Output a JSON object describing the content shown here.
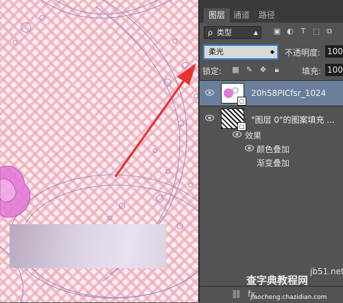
{
  "panel": {
    "tabs": [
      {
        "label": "图层",
        "active": true
      },
      {
        "label": "通道",
        "active": false
      },
      {
        "label": "路径",
        "active": false
      }
    ],
    "filter": {
      "kind_label": "类型",
      "icons": [
        "image-filter-icon",
        "adjustment-filter-icon",
        "text-filter-icon",
        "shape-filter-icon",
        "smart-object-filter-icon"
      ]
    },
    "blend": {
      "mode": "柔光",
      "opacity_label": "不透明度:",
      "opacity_value": "100"
    },
    "lock": {
      "label": "锁定:",
      "fill_label": "填充:",
      "fill_value": "100"
    },
    "layers": [
      {
        "name": "20h58PICfsr_1024",
        "selected": true,
        "visible": true
      },
      {
        "name": "\"图层 0\"的图案填充 ...",
        "selected": false,
        "visible": true
      }
    ],
    "effects": {
      "label": "效果",
      "items": [
        "颜色叠加",
        "渐变叠加"
      ]
    }
  },
  "watermark": {
    "site": "查字典教程网",
    "url": "jb51.net",
    "domain": "jiaocheng.chazidian.com"
  },
  "colors": {
    "selection": "#6a7f9b",
    "panel_bg": "#535353",
    "arrow": "#e8322f",
    "focus": "#2f84d6"
  }
}
